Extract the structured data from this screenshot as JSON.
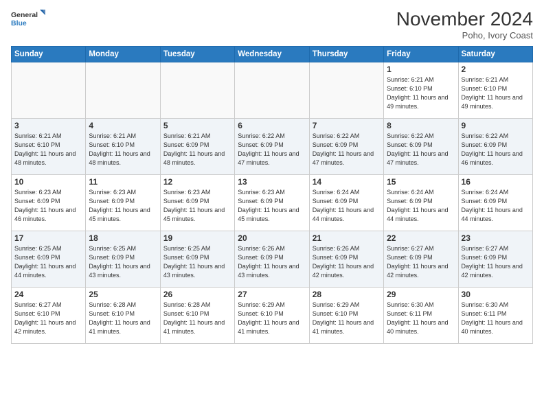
{
  "logo": {
    "line1": "General",
    "line2": "Blue"
  },
  "title": "November 2024",
  "subtitle": "Poho, Ivory Coast",
  "days_header": [
    "Sunday",
    "Monday",
    "Tuesday",
    "Wednesday",
    "Thursday",
    "Friday",
    "Saturday"
  ],
  "weeks": [
    [
      {
        "day": "",
        "info": ""
      },
      {
        "day": "",
        "info": ""
      },
      {
        "day": "",
        "info": ""
      },
      {
        "day": "",
        "info": ""
      },
      {
        "day": "",
        "info": ""
      },
      {
        "day": "1",
        "info": "Sunrise: 6:21 AM\nSunset: 6:10 PM\nDaylight: 11 hours\nand 49 minutes."
      },
      {
        "day": "2",
        "info": "Sunrise: 6:21 AM\nSunset: 6:10 PM\nDaylight: 11 hours\nand 49 minutes."
      }
    ],
    [
      {
        "day": "3",
        "info": "Sunrise: 6:21 AM\nSunset: 6:10 PM\nDaylight: 11 hours\nand 48 minutes."
      },
      {
        "day": "4",
        "info": "Sunrise: 6:21 AM\nSunset: 6:10 PM\nDaylight: 11 hours\nand 48 minutes."
      },
      {
        "day": "5",
        "info": "Sunrise: 6:21 AM\nSunset: 6:09 PM\nDaylight: 11 hours\nand 48 minutes."
      },
      {
        "day": "6",
        "info": "Sunrise: 6:22 AM\nSunset: 6:09 PM\nDaylight: 11 hours\nand 47 minutes."
      },
      {
        "day": "7",
        "info": "Sunrise: 6:22 AM\nSunset: 6:09 PM\nDaylight: 11 hours\nand 47 minutes."
      },
      {
        "day": "8",
        "info": "Sunrise: 6:22 AM\nSunset: 6:09 PM\nDaylight: 11 hours\nand 47 minutes."
      },
      {
        "day": "9",
        "info": "Sunrise: 6:22 AM\nSunset: 6:09 PM\nDaylight: 11 hours\nand 46 minutes."
      }
    ],
    [
      {
        "day": "10",
        "info": "Sunrise: 6:23 AM\nSunset: 6:09 PM\nDaylight: 11 hours\nand 46 minutes."
      },
      {
        "day": "11",
        "info": "Sunrise: 6:23 AM\nSunset: 6:09 PM\nDaylight: 11 hours\nand 45 minutes."
      },
      {
        "day": "12",
        "info": "Sunrise: 6:23 AM\nSunset: 6:09 PM\nDaylight: 11 hours\nand 45 minutes."
      },
      {
        "day": "13",
        "info": "Sunrise: 6:23 AM\nSunset: 6:09 PM\nDaylight: 11 hours\nand 45 minutes."
      },
      {
        "day": "14",
        "info": "Sunrise: 6:24 AM\nSunset: 6:09 PM\nDaylight: 11 hours\nand 44 minutes."
      },
      {
        "day": "15",
        "info": "Sunrise: 6:24 AM\nSunset: 6:09 PM\nDaylight: 11 hours\nand 44 minutes."
      },
      {
        "day": "16",
        "info": "Sunrise: 6:24 AM\nSunset: 6:09 PM\nDaylight: 11 hours\nand 44 minutes."
      }
    ],
    [
      {
        "day": "17",
        "info": "Sunrise: 6:25 AM\nSunset: 6:09 PM\nDaylight: 11 hours\nand 44 minutes."
      },
      {
        "day": "18",
        "info": "Sunrise: 6:25 AM\nSunset: 6:09 PM\nDaylight: 11 hours\nand 43 minutes."
      },
      {
        "day": "19",
        "info": "Sunrise: 6:25 AM\nSunset: 6:09 PM\nDaylight: 11 hours\nand 43 minutes."
      },
      {
        "day": "20",
        "info": "Sunrise: 6:26 AM\nSunset: 6:09 PM\nDaylight: 11 hours\nand 43 minutes."
      },
      {
        "day": "21",
        "info": "Sunrise: 6:26 AM\nSunset: 6:09 PM\nDaylight: 11 hours\nand 42 minutes."
      },
      {
        "day": "22",
        "info": "Sunrise: 6:27 AM\nSunset: 6:09 PM\nDaylight: 11 hours\nand 42 minutes."
      },
      {
        "day": "23",
        "info": "Sunrise: 6:27 AM\nSunset: 6:09 PM\nDaylight: 11 hours\nand 42 minutes."
      }
    ],
    [
      {
        "day": "24",
        "info": "Sunrise: 6:27 AM\nSunset: 6:10 PM\nDaylight: 11 hours\nand 42 minutes."
      },
      {
        "day": "25",
        "info": "Sunrise: 6:28 AM\nSunset: 6:10 PM\nDaylight: 11 hours\nand 41 minutes."
      },
      {
        "day": "26",
        "info": "Sunrise: 6:28 AM\nSunset: 6:10 PM\nDaylight: 11 hours\nand 41 minutes."
      },
      {
        "day": "27",
        "info": "Sunrise: 6:29 AM\nSunset: 6:10 PM\nDaylight: 11 hours\nand 41 minutes."
      },
      {
        "day": "28",
        "info": "Sunrise: 6:29 AM\nSunset: 6:10 PM\nDaylight: 11 hours\nand 41 minutes."
      },
      {
        "day": "29",
        "info": "Sunrise: 6:30 AM\nSunset: 6:11 PM\nDaylight: 11 hours\nand 40 minutes."
      },
      {
        "day": "30",
        "info": "Sunrise: 6:30 AM\nSunset: 6:11 PM\nDaylight: 11 hours\nand 40 minutes."
      }
    ]
  ]
}
